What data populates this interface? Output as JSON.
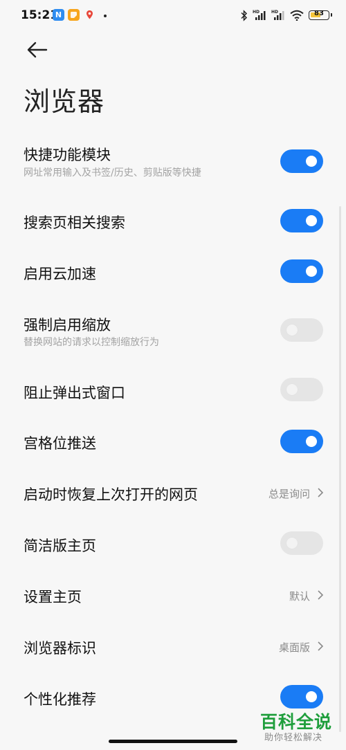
{
  "status_bar": {
    "time": "15:21",
    "app_icon_n": "N",
    "battery_level": "83",
    "icons": [
      "n-app-icon",
      "notes-app-icon",
      "location-app-icon",
      "bluetooth-icon",
      "hd-signal-icon",
      "hd-signal-icon",
      "wifi-icon",
      "battery-icon"
    ]
  },
  "header": {
    "back_icon": "back-arrow-icon",
    "title": "浏览器"
  },
  "settings": [
    {
      "title": "快捷功能模块",
      "subtitle": "网址常用输入及书签/历史、剪贴版等快捷",
      "toggle": true
    },
    {
      "title": "搜索页相关搜索",
      "toggle": true
    },
    {
      "title": "启用云加速",
      "toggle": true
    },
    {
      "title": "强制启用缩放",
      "subtitle": "替换网站的请求以控制缩放行为",
      "toggle": false
    },
    {
      "title": "阻止弹出式窗口",
      "toggle": false
    },
    {
      "title": "宫格位推送",
      "toggle": true
    },
    {
      "title": "启动时恢复上次打开的网页",
      "value": "总是询问"
    },
    {
      "title": "简洁版主页",
      "toggle": false
    },
    {
      "title": "设置主页",
      "value": "默认"
    },
    {
      "title": "浏览器标识",
      "value": "桌面版"
    },
    {
      "title": "个性化推荐",
      "toggle": true
    }
  ],
  "watermark": {
    "title": "百科全说",
    "subtitle": "助你轻松解决"
  },
  "colors": {
    "accent": "#1a7cf5",
    "toggle_off": "#e5e5e5",
    "background": "#f7f7f7",
    "watermark": "#1f9e3c"
  }
}
